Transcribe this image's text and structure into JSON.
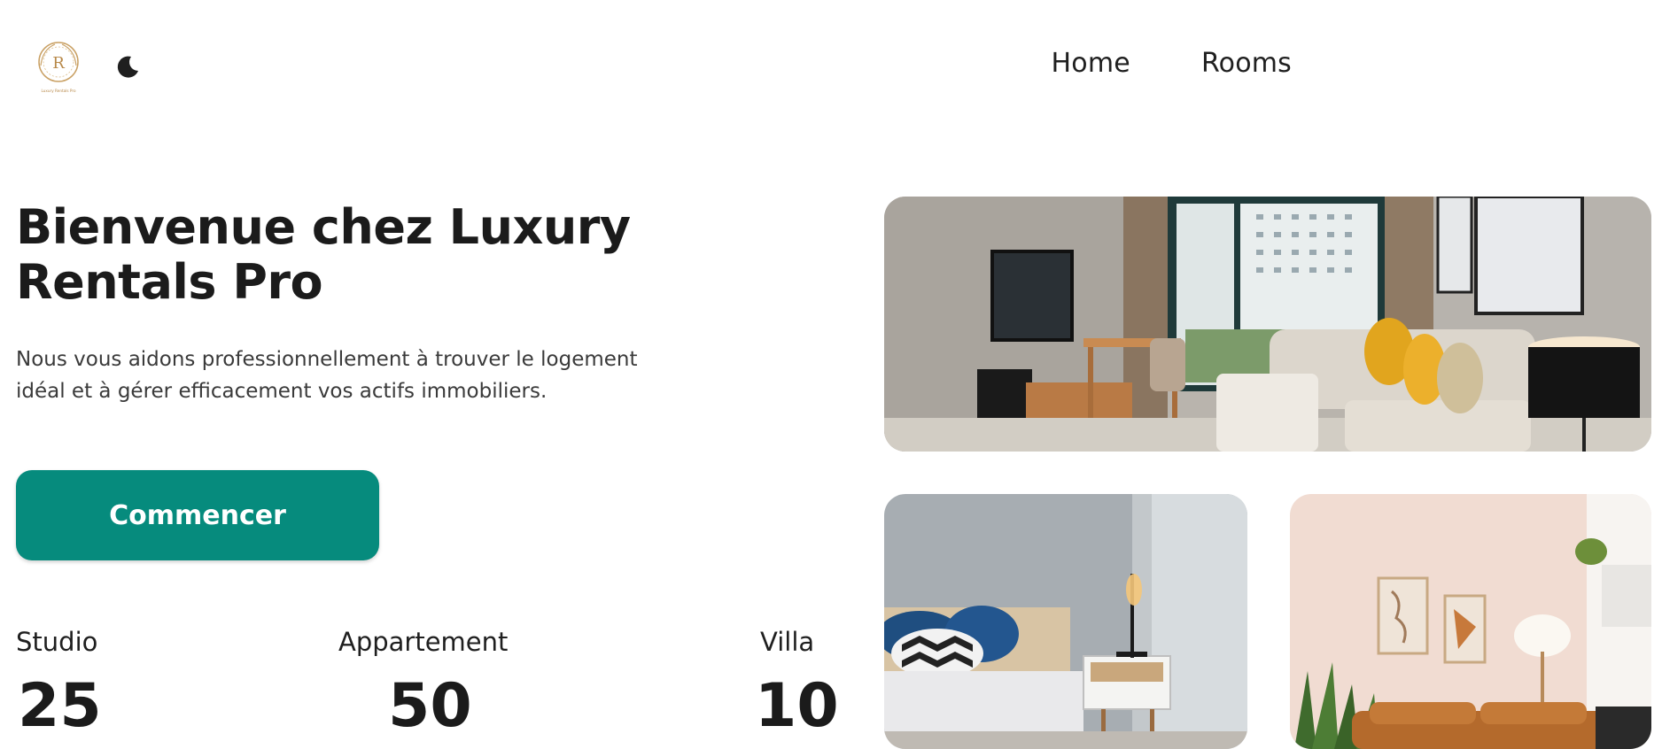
{
  "header": {
    "logo_text": "R",
    "logo_caption": "Luxury Rentals Pro",
    "theme_toggle_icon": "moon-icon",
    "nav": [
      {
        "label": "Home"
      },
      {
        "label": "Rooms"
      }
    ]
  },
  "hero": {
    "title": "Bienvenue chez Luxury Rentals Pro",
    "description": "Nous vous aidons professionnellement à trouver le logement idéal et à gérer efficacement vos actifs immobiliers.",
    "cta_label": "Commencer"
  },
  "stats": [
    {
      "label": "Studio",
      "value": "25"
    },
    {
      "label": "Appartement",
      "value": "50"
    },
    {
      "label": "Villa",
      "value": "10"
    }
  ],
  "colors": {
    "accent": "#068b7d",
    "text": "#1b1b1b",
    "logo_gold": "#c9a063"
  }
}
